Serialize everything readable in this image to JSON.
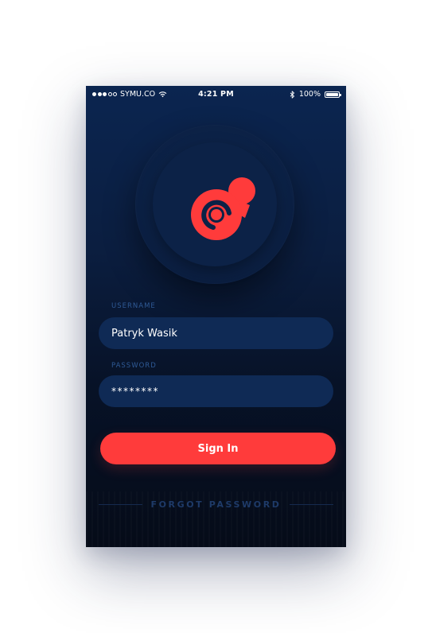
{
  "status_bar": {
    "signal_full_dots": 3,
    "signal_empty_dots": 2,
    "carrier": "SYMU.CO",
    "wifi_icon": "wifi-icon",
    "time": "4:21 PM",
    "bluetooth_icon": "bluetooth-icon",
    "battery_percent_label": "100%",
    "battery_level": 1.0
  },
  "logo": {
    "icon": "app-logo-icon",
    "color": "#ff3b3b"
  },
  "form": {
    "username": {
      "label": "USERNAME",
      "value": "Patryk Wasik"
    },
    "password": {
      "label": "PASSWORD",
      "value": "********"
    },
    "sign_in_label": "Sign In",
    "forgot_password_label": "FORGOT PASSWORD"
  },
  "colors": {
    "accent": "#ff3b3b",
    "background_top": "#0b2550",
    "background_bottom": "#050b18",
    "field_background": "#0f2a55",
    "label_color": "#2f5a96"
  }
}
